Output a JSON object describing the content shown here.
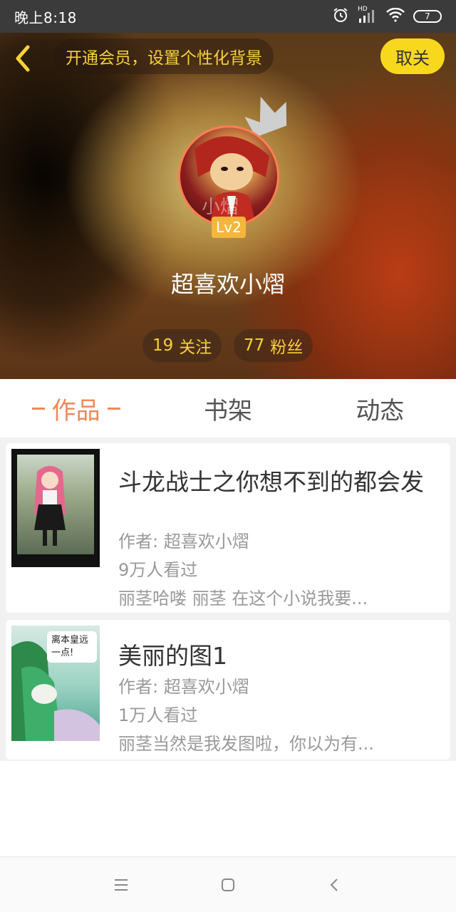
{
  "status_bar": {
    "time": "晚上8:18",
    "signal_label": "HD",
    "battery": "7"
  },
  "header": {
    "vip_text": "开通会员，设置个性化背景",
    "cancel_follow": "取关",
    "avatar_watermark": "小熠",
    "level": "Lv2",
    "nickname": "超喜欢小熠",
    "follow_count": "19",
    "follow_label": "关注",
    "fans_count": "77",
    "fans_label": "粉丝"
  },
  "tabs": [
    {
      "label": "作品",
      "active": true
    },
    {
      "label": "书架",
      "active": false
    },
    {
      "label": "动态",
      "active": false
    }
  ],
  "works": [
    {
      "title": "斗龙战士之你想不到的都会发",
      "author": "作者: 超喜欢小熠",
      "views": "9万人看过",
      "desc": "丽茎哈喽 丽茎 在这个小说我要..."
    },
    {
      "title": "美丽的图1",
      "author": "作者: 超喜欢小熠",
      "views": "1万人看过",
      "desc": "丽茎当然是我发图啦，你以为有...",
      "cover_text": "离本皇远一点!"
    }
  ],
  "colors": {
    "accent": "#f0885a",
    "vip_yellow": "#f6d23a",
    "cancel_btn": "#f8d81c",
    "level_badge": "#f4b63c"
  },
  "icons": [
    "back-arrow-icon",
    "crown-icon",
    "alarm-icon",
    "signal-icon",
    "wifi-icon",
    "battery-icon",
    "menu-icon",
    "home-icon",
    "back-icon"
  ]
}
